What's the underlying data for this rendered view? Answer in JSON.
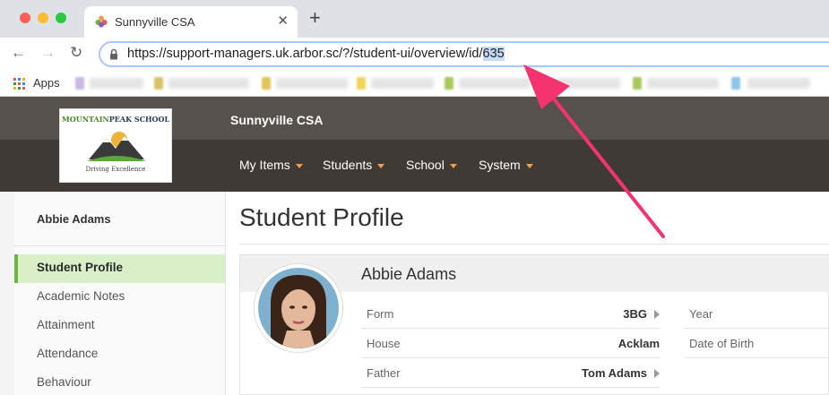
{
  "browser": {
    "tab_title": "Sunnyville CSA",
    "tab_close": "✕",
    "new_tab": "+",
    "url_main": "https://support-managers.uk.arbor.sc/?/student-ui/overview/id/",
    "url_highlight": "635",
    "bookmarks_apps": "Apps",
    "nav_back": "←",
    "nav_forward": "→",
    "nav_reload": "↻"
  },
  "site": {
    "logo_text_top_a": "MOUNTAIN",
    "logo_text_top_b": "PEAK SCHOOL",
    "logo_tagline": "Driving Excellence",
    "title": "Sunnyville CSA",
    "menu": [
      "My Items",
      "Students",
      "School",
      "System"
    ],
    "accent_color": "#f0a04b"
  },
  "sidebar": {
    "student_name": "Abbie Adams",
    "items": [
      "Student Profile",
      "Academic Notes",
      "Attainment",
      "Attendance",
      "Behaviour"
    ],
    "active_color": "#6cb33f"
  },
  "main": {
    "page_title": "Student Profile",
    "profile_name": "Abbie Adams",
    "left_rows": [
      {
        "label": "Form",
        "value": "3BG"
      },
      {
        "label": "House",
        "value": "Acklam"
      },
      {
        "label": "Father",
        "value": "Tom Adams"
      }
    ],
    "right_rows": [
      {
        "label": "Year"
      },
      {
        "label": "Date of Birth"
      }
    ]
  },
  "annotation": {
    "arrow_color": "#f5336f"
  }
}
